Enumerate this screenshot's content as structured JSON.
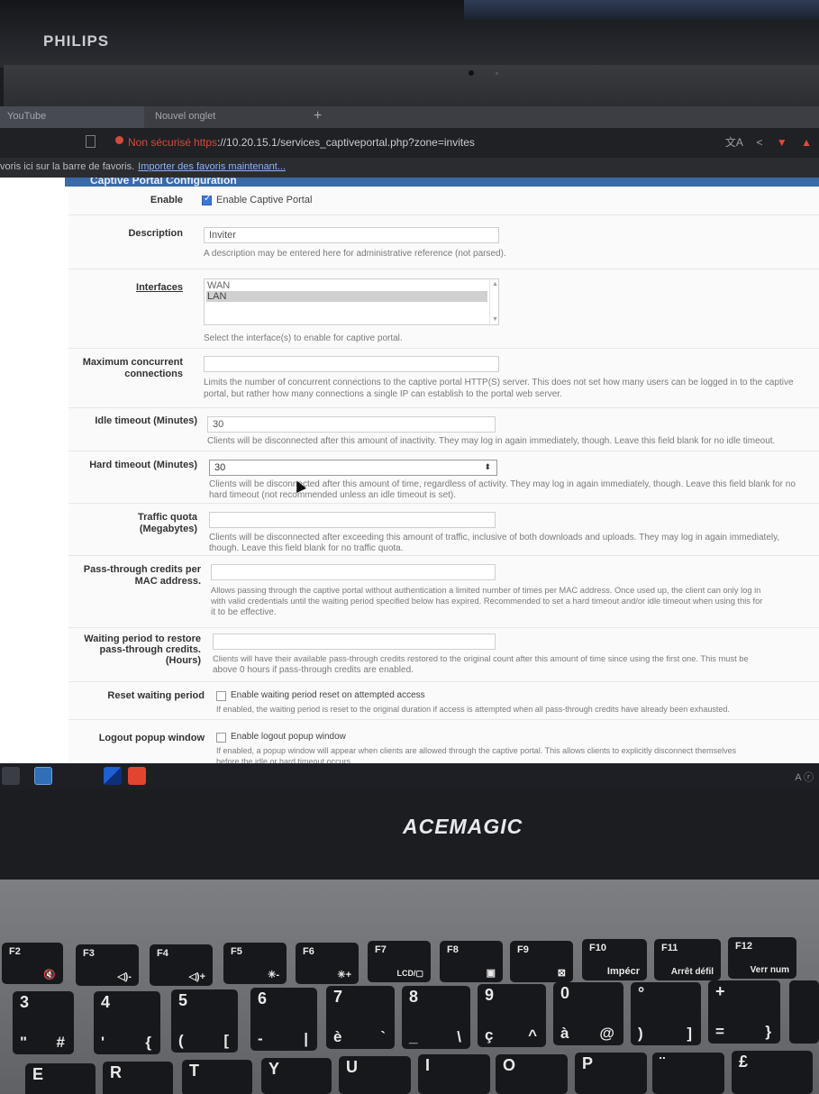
{
  "monitor": {
    "brand": "PHILIPS"
  },
  "browser": {
    "tabs": [
      {
        "label": "YouTube"
      },
      {
        "label": "Nouvel onglet"
      }
    ],
    "new_tab": "+",
    "security_label": "Non sécurisé",
    "url_protocol": "https",
    "url_rest": "://10.20.15.1/services_captiveportal.php?zone=invites",
    "bookmarks_text": "voris ici sur la barre de favoris.",
    "bookmarks_link": "Importer des favoris maintenant..."
  },
  "panel": {
    "title": "Captive Portal Configuration"
  },
  "form": {
    "enable": {
      "label": "Enable",
      "checkbox_label": "Enable Captive Portal",
      "checked": true
    },
    "description": {
      "label": "Description",
      "value": "Inviter",
      "help": "A description may be entered here for administrative reference (not parsed)."
    },
    "interfaces": {
      "label": "Interfaces",
      "options": [
        "WAN",
        "LAN"
      ],
      "selected": "LAN",
      "help": "Select the interface(s) to enable for captive portal."
    },
    "max_conn": {
      "label_1": "Maximum concurrent",
      "label_2": "connections",
      "value": "",
      "help_1": "Limits the number of concurrent connections to the captive portal HTTP(S) server. This does not set how many users can be logged in to the captive",
      "help_2": "portal, but rather how many connections a single IP can establish to the portal web server."
    },
    "idle_timeout": {
      "label": "Idle timeout (Minutes)",
      "value": "30",
      "help": "Clients will be disconnected after this amount of inactivity. They may log in again immediately, though. Leave this field blank for no idle timeout."
    },
    "hard_timeout": {
      "label": "Hard timeout (Minutes)",
      "value": "30",
      "help_1": "Clients will be disconnected after this amount of time, regardless of activity. They may log in again immediately, though. Leave this field blank for no",
      "help_2": "hard timeout (not recommended unless an idle timeout is set)."
    },
    "traffic_quota": {
      "label_1": "Traffic quota",
      "label_2": "(Megabytes)",
      "value": "",
      "help_1": "Clients will be disconnected after exceeding this amount of traffic, inclusive of both downloads and uploads. They may log in again immediately,",
      "help_2": "though. Leave this field blank for no traffic quota."
    },
    "passthru": {
      "label_1": "Pass-through credits per",
      "label_2": "MAC address.",
      "value": "",
      "help_1": "Allows passing through the captive portal without authentication a limited number of times per MAC address. Once used up, the client can only log in",
      "help_2": "with valid credentials until the waiting period specified below has expired. Recommended to set a hard timeout and/or idle timeout when using this for",
      "help_3": "it to be effective."
    },
    "waiting_period": {
      "label_1": "Waiting period to restore",
      "label_2": "pass-through credits.",
      "label_3": "(Hours)",
      "value": "",
      "help_1": "Clients will have their available pass-through credits restored to the original count after this amount of time since using the first one. This must be",
      "help_2": "above 0 hours if pass-through credits are enabled."
    },
    "reset_waiting": {
      "label": "Reset waiting period",
      "checkbox_label": "Enable waiting period reset on attempted access",
      "checked": false,
      "help": "If enabled, the waiting period is reset to the original duration if access is attempted when all pass-through credits have already been exhausted."
    },
    "logout_popup": {
      "label": "Logout popup window",
      "checkbox_label": "Enable logout popup window",
      "checked": false,
      "help_1": "If enabled, a popup window will appear when clients are allowed through the captive portal. This allows clients to explicitly disconnect themselves",
      "help_2": "before the idle or hard timeout occurs."
    }
  },
  "taskbar": {
    "right_text": "A ⓡ"
  },
  "laptop": {
    "brand": "ACEMAGIC"
  },
  "keyboard": {
    "fn_row": [
      {
        "top": "F2",
        "sub": "🔇"
      },
      {
        "top": "F3",
        "sub": "◁)-"
      },
      {
        "top": "F4",
        "sub": "◁)+"
      },
      {
        "top": "F5",
        "sub": "✳-"
      },
      {
        "top": "F6",
        "sub": "✳+"
      },
      {
        "top": "F7",
        "sub": "LCD/▢"
      },
      {
        "top": "F8",
        "sub": "▣"
      },
      {
        "top": "F9",
        "sub": "⊠"
      },
      {
        "top": "F10",
        "sub": "Impécr"
      },
      {
        "top": "F11",
        "sub": "Arrêt défil"
      },
      {
        "top": "F12",
        "sub": "Verr num"
      }
    ],
    "num_row": [
      {
        "top": "3",
        "bl": "\"",
        "br": "#"
      },
      {
        "top": "4",
        "bl": "'",
        "br": "{"
      },
      {
        "top": "5",
        "bl": "(",
        "br": "["
      },
      {
        "top": "6",
        "bl": "-",
        "br": "|"
      },
      {
        "top": "7",
        "bl": "è",
        "br": "`"
      },
      {
        "top": "8",
        "bl": "_",
        "br": "\\"
      },
      {
        "top": "9",
        "bl": "ç",
        "br": "^"
      },
      {
        "top": "0",
        "bl": "à",
        "br": "@"
      },
      {
        "top": "°",
        "bl": ")",
        "br": "]"
      },
      {
        "top": "+",
        "bl": "=",
        "br": "}"
      }
    ],
    "letter_row": [
      "E",
      "R",
      "T",
      "Y",
      "U",
      "I",
      "O",
      "P",
      "¨",
      "£"
    ]
  }
}
